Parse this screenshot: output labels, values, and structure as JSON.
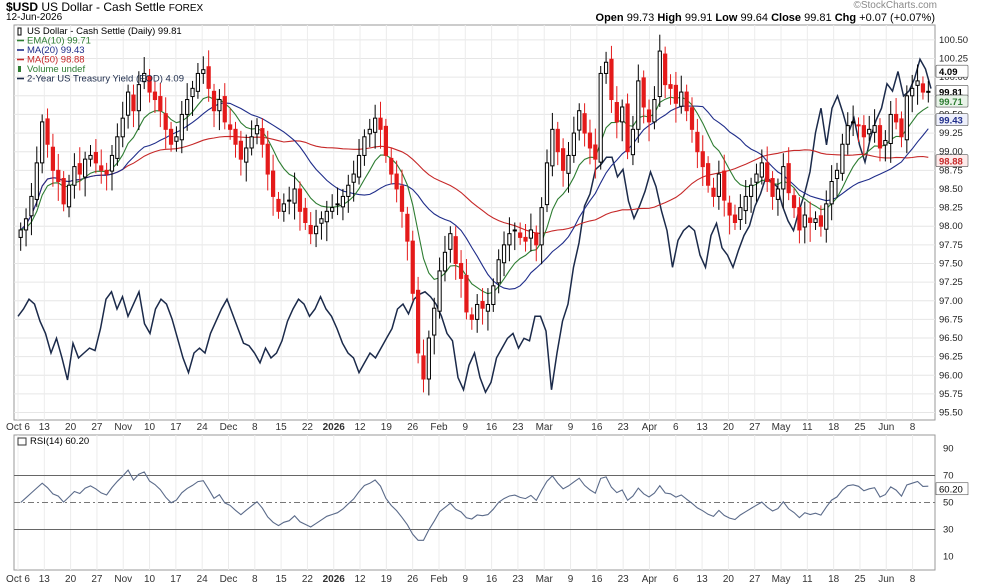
{
  "header": {
    "symbol": "$USD",
    "name": "US Dollar - Cash Settle",
    "exchange": "FOREX",
    "date": "12-Jun-2026",
    "ohlc_open_label": "Open",
    "ohlc_open": "99.73",
    "ohlc_high_label": "High",
    "ohlc_high": "99.91",
    "ohlc_low_label": "Low",
    "ohlc_low": "99.64",
    "ohlc_close_label": "Close",
    "ohlc_close": "99.81",
    "ohlc_chg_label": "Chg",
    "ohlc_chg": "+0.07 (+0.07%)",
    "brand": "©StockCharts.com",
    "brand_color": "#8a8a8a"
  },
  "legend": [
    {
      "text": "US Dollar - Cash Settle (Daily) 99.81",
      "color": "#000000",
      "icon": "candle-icon"
    },
    {
      "text": "EMA(10) 99.71",
      "color": "#2e7d32",
      "icon": "line-icon"
    },
    {
      "text": "MA(20) 99.43",
      "color": "#1f2d8a",
      "icon": "line-icon"
    },
    {
      "text": "MA(50) 98.88",
      "color": "#c62828",
      "icon": "line-icon"
    },
    {
      "text": "Volume undef",
      "color": "#2e7d32",
      "icon": "bar-icon"
    },
    {
      "text": "2-Year US Treasury Yield (EOD) 4.09",
      "color": "#1b2a4a",
      "icon": "line-icon"
    }
  ],
  "rsi_label": "RSI(14) 60.20",
  "value_tags": {
    "close": "99.81",
    "ema": "99.71",
    "ma20": "99.43",
    "ma50": "98.88",
    "yield": "4.09",
    "rsi": "60.20"
  },
  "colors": {
    "up": "#000000",
    "down": "#e41a1a",
    "ema": "#2e7d32",
    "ma20": "#1f2d8a",
    "ma50": "#c62828",
    "yield": "#1b2a4a",
    "rsi": "#5b6b8a",
    "rsi_fill": "#7aa3a0"
  },
  "chart_data": {
    "type": "candlestick",
    "title": "US Dollar - Cash Settle (Daily)",
    "ylim": [
      95.4,
      100.7
    ],
    "yticks": [
      "100.50",
      "100.25",
      "100.00",
      "99.75",
      "99.50",
      "99.25",
      "99.00",
      "98.75",
      "98.50",
      "98.25",
      "98.00",
      "97.75",
      "97.50",
      "97.25",
      "97.00",
      "96.75",
      "96.50",
      "96.25",
      "96.00",
      "95.75",
      "95.50"
    ],
    "xticks": [
      "Oct 6",
      "13",
      "20",
      "27",
      "Nov",
      "10",
      "17",
      "24",
      "Dec",
      "8",
      "15",
      "22",
      "2026",
      "12",
      "19",
      "26",
      "Feb",
      "9",
      "16",
      "23",
      "Mar",
      "9",
      "16",
      "23",
      "Apr",
      "6",
      "13",
      "20",
      "27",
      "May",
      "11",
      "18",
      "25",
      "Jun",
      "8"
    ],
    "close": [
      97.95,
      98.1,
      98.4,
      98.85,
      99.4,
      99.1,
      98.75,
      98.6,
      98.3,
      98.55,
      98.8,
      98.7,
      98.9,
      98.95,
      98.85,
      98.75,
      98.7,
      98.95,
      99.2,
      99.45,
      99.8,
      99.55,
      99.9,
      100.05,
      99.8,
      99.7,
      99.55,
      99.3,
      99.1,
      99.2,
      99.5,
      99.7,
      99.85,
      100.05,
      100.1,
      99.85,
      99.55,
      99.7,
      99.4,
      99.3,
      99.1,
      98.9,
      99.05,
      99.2,
      99.35,
      99.1,
      98.7,
      98.4,
      98.2,
      98.3,
      98.35,
      98.5,
      98.2,
      98.05,
      97.9,
      98.0,
      98.1,
      98.2,
      98.25,
      98.3,
      98.4,
      98.55,
      98.7,
      98.95,
      99.2,
      99.3,
      99.45,
      99.3,
      98.95,
      98.7,
      98.5,
      98.2,
      97.8,
      97.1,
      96.3,
      95.95,
      96.5,
      96.9,
      97.4,
      97.65,
      97.9,
      97.5,
      97.3,
      96.85,
      96.75,
      96.95,
      96.9,
      96.95,
      97.2,
      97.55,
      97.75,
      97.9,
      97.95,
      97.85,
      97.8,
      97.95,
      97.75,
      98.25,
      98.85,
      99.3,
      99.0,
      98.75,
      98.95,
      99.25,
      99.55,
      99.25,
      99.05,
      98.9,
      100.05,
      100.2,
      99.7,
      99.4,
      99.6,
      99.0,
      99.3,
      99.95,
      99.6,
      99.4,
      99.7,
      100.35,
      99.9,
      99.85,
      99.65,
      99.8,
      99.55,
      99.3,
      99.0,
      98.8,
      98.55,
      98.4,
      98.7,
      98.35,
      98.15,
      98.05,
      98.25,
      98.4,
      98.55,
      98.7,
      98.85,
      98.6,
      98.4,
      98.5,
      98.8,
      98.45,
      98.25,
      97.95,
      98.15,
      98.05,
      98.1,
      98.0,
      98.3,
      98.6,
      98.75,
      99.1,
      99.35,
      99.4,
      99.35,
      99.2,
      99.3,
      99.35,
      99.05,
      99.15,
      99.5,
      99.4,
      99.2,
      99.75,
      99.85,
      99.95,
      99.8,
      99.81
    ],
    "ema10_last": 99.71,
    "ma20_last": 99.43,
    "ma50_last": 98.88,
    "yield_last": 4.09,
    "yield_series": [
      0.35,
      0.38,
      0.42,
      0.4,
      0.33,
      0.28,
      0.2,
      0.26,
      0.18,
      0.09,
      0.24,
      0.18,
      0.2,
      0.22,
      0.21,
      0.3,
      0.42,
      0.45,
      0.38,
      0.43,
      0.35,
      0.4,
      0.45,
      0.32,
      0.28,
      0.38,
      0.42,
      0.4,
      0.34,
      0.26,
      0.18,
      0.12,
      0.2,
      0.22,
      0.2,
      0.28,
      0.33,
      0.38,
      0.42,
      0.36,
      0.3,
      0.24,
      0.23,
      0.2,
      0.16,
      0.22,
      0.18,
      0.2,
      0.25,
      0.33,
      0.38,
      0.42,
      0.4,
      0.35,
      0.38,
      0.43,
      0.38,
      0.35,
      0.3,
      0.24,
      0.2,
      0.18,
      0.12,
      0.16,
      0.2,
      0.18,
      0.22,
      0.26,
      0.3,
      0.38,
      0.4,
      0.36,
      0.42,
      0.44,
      0.45,
      0.43,
      0.4,
      0.35,
      0.28,
      0.25,
      0.1,
      0.05,
      0.15,
      0.2,
      0.1,
      0.04,
      0.08,
      0.18,
      0.22,
      0.26,
      0.28,
      0.22,
      0.26,
      0.25,
      0.35,
      0.35,
      0.29,
      0.05,
      0.2,
      0.33,
      0.4,
      0.55,
      0.65,
      0.8,
      0.85,
      0.95,
      0.97,
      1.0,
      1.0,
      0.92,
      0.95,
      0.82,
      0.75,
      0.8,
      0.86,
      0.94,
      0.88,
      0.78,
      0.7,
      0.55,
      0.66,
      0.7,
      0.72,
      0.7,
      0.6,
      0.55,
      0.68,
      0.73,
      0.63,
      0.6,
      0.55,
      0.62,
      0.68,
      0.72,
      0.8,
      0.85,
      0.92,
      0.9,
      0.88,
      0.8,
      0.74,
      0.7,
      0.78,
      0.85,
      0.94,
      1.1,
      1.2,
      1.05,
      1.2,
      1.25,
      1.18,
      1.1,
      1.16,
      1.05,
      0.98,
      1.08,
      1.15,
      1.2,
      1.3,
      1.27,
      1.35,
      1.25,
      1.27,
      1.32,
      1.4,
      1.36,
      1.28
    ]
  },
  "rsi_chart": {
    "type": "line",
    "ylim": [
      0,
      100
    ],
    "yticks": [
      "90",
      "70",
      "50",
      "30",
      "10"
    ],
    "overbought": 70,
    "oversold": 30,
    "mid": 50,
    "last": 60.2
  }
}
